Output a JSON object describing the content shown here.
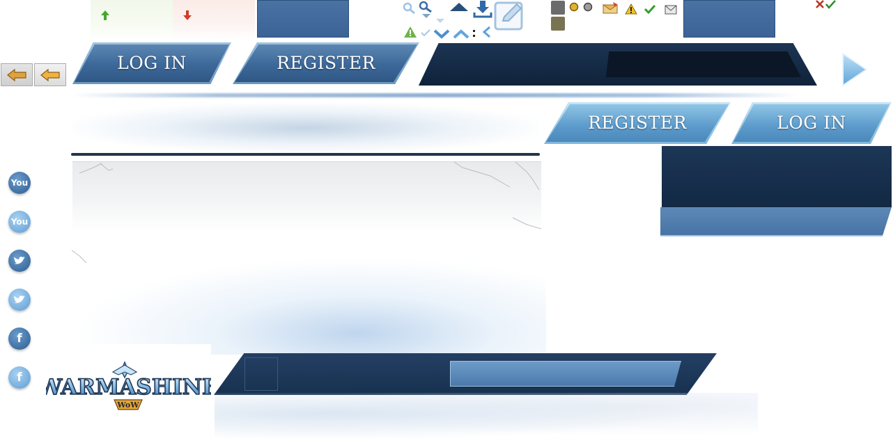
{
  "auth": {
    "login_label": "LOG IN",
    "register_label": "REGISTER"
  },
  "search": {
    "value": "",
    "placeholder": ""
  },
  "logo": {
    "text": "WARMASHINE",
    "subtext": "WoW"
  },
  "social": [
    {
      "icon": "youtube-icon",
      "glyph": "You"
    },
    {
      "icon": "youtube-icon",
      "glyph": "You"
    },
    {
      "icon": "twitter-icon",
      "glyph": ""
    },
    {
      "icon": "twitter-icon",
      "glyph": ""
    },
    {
      "icon": "facebook-icon",
      "glyph": "f"
    },
    {
      "icon": "facebook-icon",
      "glyph": "f"
    }
  ],
  "colors": {
    "dark_navy": "#132944",
    "button_blue": "#3c6899",
    "light_blue": "#5b9acb",
    "arrow_gold": "#e0a33c"
  }
}
